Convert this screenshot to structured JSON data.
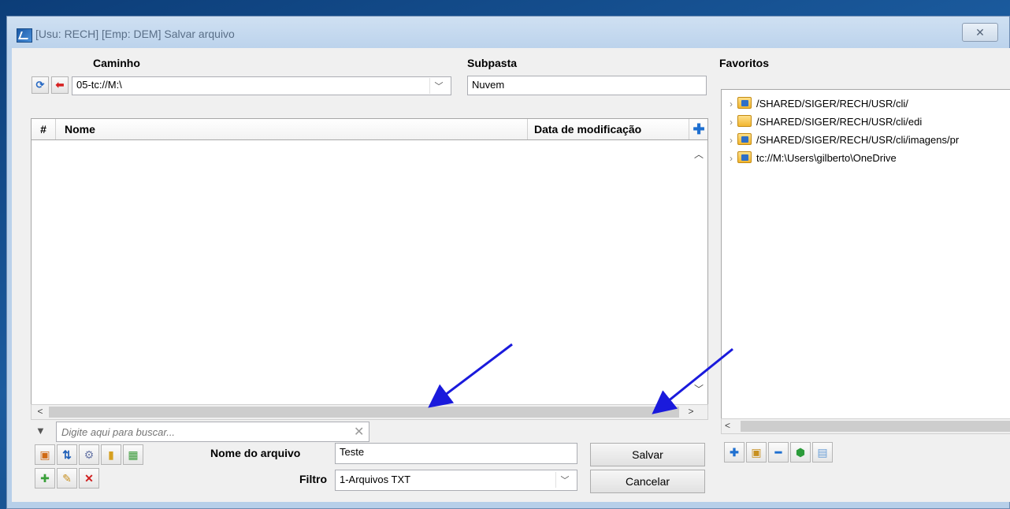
{
  "window": {
    "title": "[Usu: RECH] [Emp: DEM] Salvar arquivo",
    "close_glyph": "✕"
  },
  "path": {
    "label": "Caminho",
    "value": "05-tc://M:\\"
  },
  "subfolder": {
    "label": "Subpasta",
    "value": "Nuvem"
  },
  "favorites": {
    "label": "Favoritos",
    "items": [
      {
        "text": "/SHARED/SIGER/RECH/USR/cli/",
        "icon": "network-folder-icon"
      },
      {
        "text": "/SHARED/SIGER/RECH/USR/cli/edi",
        "icon": "folder-icon"
      },
      {
        "text": "/SHARED/SIGER/RECH/USR/cli/imagens/pr",
        "icon": "network-folder-icon"
      },
      {
        "text": "tc://M:\\Users\\gilberto\\OneDrive",
        "icon": "network-folder-icon"
      }
    ]
  },
  "grid": {
    "columns": [
      "#",
      "Nome",
      "Data de modificação"
    ],
    "rows": []
  },
  "search": {
    "placeholder": "Digite aqui para buscar..."
  },
  "form": {
    "filename_label": "Nome do arquivo",
    "filename_value": "Teste",
    "filter_label": "Filtro",
    "filter_value": "1-Arquivos TXT"
  },
  "buttons": {
    "save": "Salvar",
    "cancel": "Cancelar"
  },
  "colors": {
    "annotation_arrow": "#1a1adc",
    "desktop": "#1b5b9e"
  }
}
